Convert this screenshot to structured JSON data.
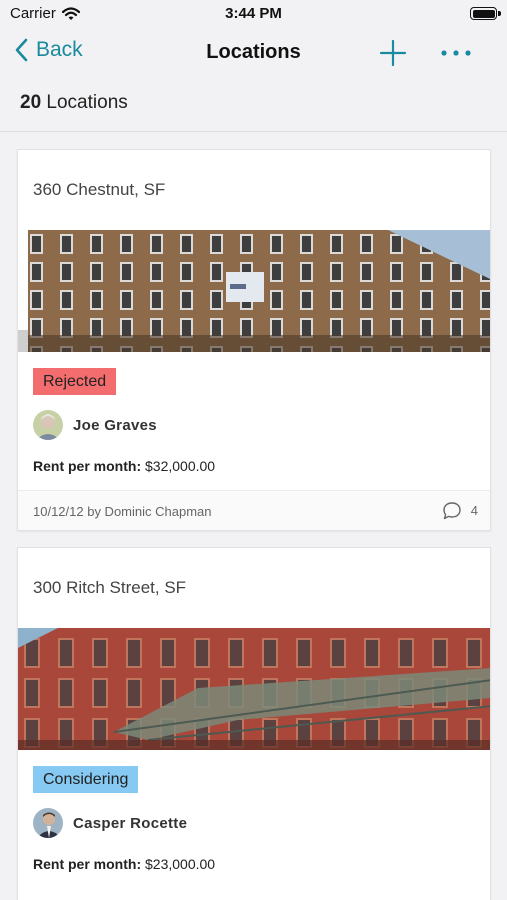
{
  "status_bar": {
    "carrier": "Carrier",
    "time": "3:44 PM"
  },
  "nav": {
    "back_label": "Back",
    "title": "Locations"
  },
  "summary": {
    "count": "20",
    "label": "Locations"
  },
  "locations": [
    {
      "address": "360 Chestnut, SF",
      "status": "Rejected",
      "status_color": "#f36d6e",
      "contact": "Joe Graves",
      "rent_label": "Rent per month:",
      "rent_value": "$32,000.00",
      "meta": "10/12/12 by Dominic Chapman",
      "comments": "4"
    },
    {
      "address": "300 Ritch Street, SF",
      "status": "Considering",
      "status_color": "#86c9f2",
      "contact": "Casper Rocette",
      "rent_label": "Rent per month:",
      "rent_value": "$23,000.00"
    }
  ],
  "colors": {
    "accent": "#1a8a9e",
    "background": "#f2f2f4"
  },
  "icons": [
    "wifi-icon",
    "battery-icon",
    "chevron-left-icon",
    "plus-icon",
    "more-icon",
    "comment-icon"
  ]
}
